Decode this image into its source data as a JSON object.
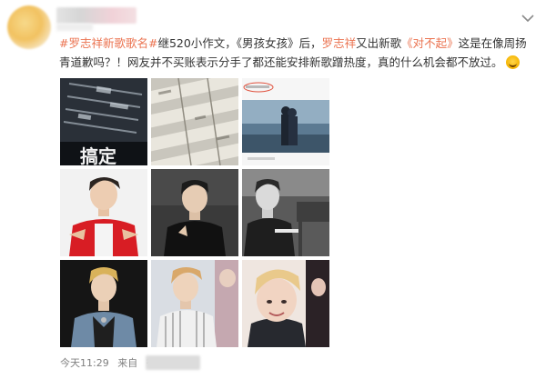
{
  "post": {
    "segments": [
      {
        "text": "#罗志祥新歌歌名#",
        "kind": "topic"
      },
      {
        "text": "继520小作文，《男孩女孩》后，",
        "kind": "plain"
      },
      {
        "text": "罗志祥",
        "kind": "at"
      },
      {
        "text": "又出新歌",
        "kind": "plain"
      },
      {
        "text": "《对不起》",
        "kind": "link"
      },
      {
        "text": "这是在像周扬",
        "kind": "plain"
      },
      {
        "text": "青道歉吗？！网友并不买账表示分手了都还能安排新歌蹭热度，真的什么机会都不放过。",
        "kind": "plain"
      }
    ]
  },
  "images": [
    {
      "name": "image-1",
      "subject": "screenshot-dark-menu",
      "caption": "搞定"
    },
    {
      "name": "image-2",
      "subject": "screenshot-table-zoom"
    },
    {
      "name": "image-3",
      "subject": "couple-at-sea"
    },
    {
      "name": "image-4",
      "subject": "man-red-jacket"
    },
    {
      "name": "image-5",
      "subject": "man-black-outfit"
    },
    {
      "name": "image-6",
      "subject": "man-bw-piano"
    },
    {
      "name": "image-7",
      "subject": "man-denim-jacket"
    },
    {
      "name": "image-8",
      "subject": "man-striped-shirt"
    },
    {
      "name": "image-9",
      "subject": "man-blonde-closeup"
    }
  ],
  "footer": {
    "time": "今天11:29",
    "source_prefix": "来自",
    "source_visible": "微"
  },
  "colors": {
    "accent": "#eb7350",
    "text": "#333333",
    "meta": "#808080"
  },
  "icons": {
    "more": "chevron-down-icon",
    "emoji": "laughing-tears-emoji-icon"
  }
}
